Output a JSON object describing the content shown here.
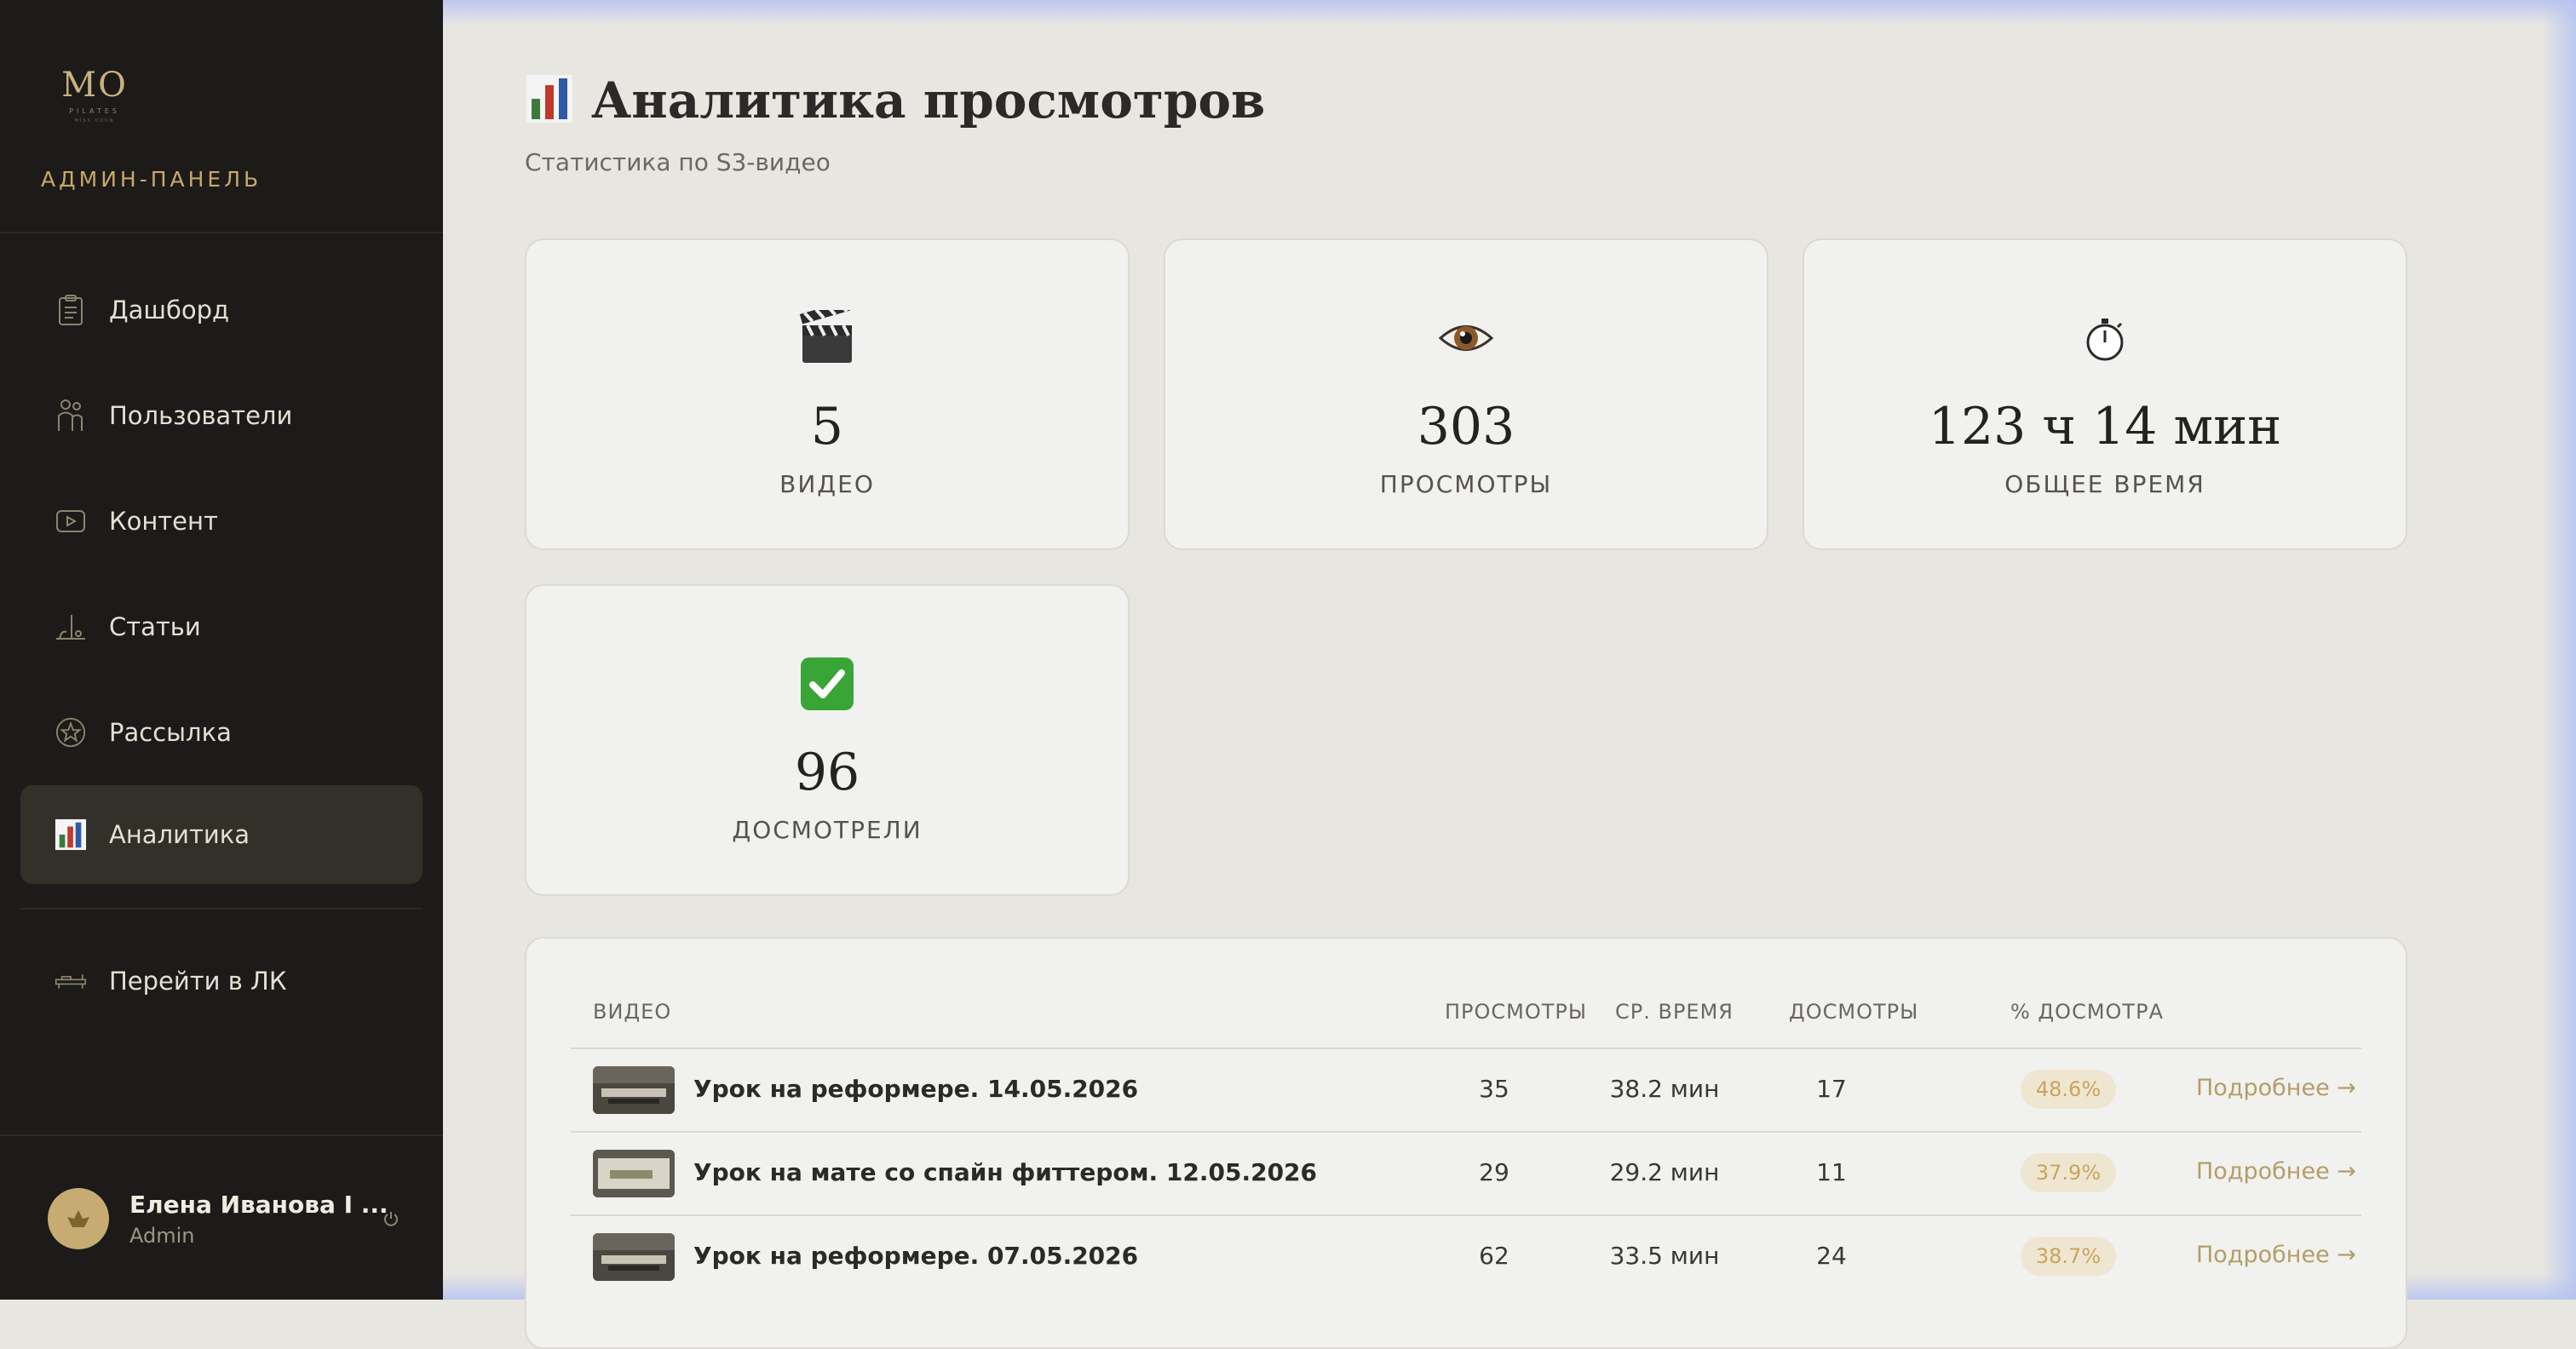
{
  "sidebar": {
    "logo_text": "MO",
    "logo_sub": "PILATES",
    "logo_sub2": "MISS ODUN",
    "brand": "АДМИН-ПАНЕЛЬ",
    "items": [
      {
        "label": "Дашборд",
        "icon": "clipboard-icon"
      },
      {
        "label": "Пользователи",
        "icon": "users-icon"
      },
      {
        "label": "Контент",
        "icon": "video-play-icon"
      },
      {
        "label": "Статьи",
        "icon": "articles-icon"
      },
      {
        "label": "Рассылка",
        "icon": "star-badge-icon"
      },
      {
        "label": "Аналитика",
        "icon": "bar-chart-icon",
        "active": true
      },
      {
        "label": "Перейти в ЛК",
        "icon": "reformer-icon"
      }
    ],
    "user": {
      "name": "Елена Иванова I ...",
      "role": "Admin"
    }
  },
  "page": {
    "title": "Аналитика просмотров",
    "subtitle": "Статистика по S3-видео"
  },
  "stats": [
    {
      "icon": "clapperboard-icon",
      "value": "5",
      "label": "ВИДЕО"
    },
    {
      "icon": "eye-icon",
      "value": "303",
      "label": "ПРОСМОТРЫ"
    },
    {
      "icon": "stopwatch-icon",
      "value": "123 ч 14 мин",
      "label": "ОБЩЕЕ ВРЕМЯ"
    },
    {
      "icon": "check-mark-icon",
      "value": "96",
      "label": "ДОСМОТРЕЛИ"
    }
  ],
  "table": {
    "columns": [
      "ВИДЕО",
      "ПРОСМОТРЫ",
      "СР. ВРЕМЯ",
      "ДОСМОТРЫ",
      "% ДОСМОТРА"
    ],
    "rows": [
      {
        "title": "Урок на реформере. 14.05.2026",
        "views": "35",
        "avg": "38.2 мин",
        "completions": "17",
        "pct": "48.6%",
        "link": "Подробнее →"
      },
      {
        "title": "Урок на мате со спайн фиттером. 12.05.2026",
        "views": "29",
        "avg": "29.2 мин",
        "completions": "11",
        "pct": "37.9%",
        "link": "Подробнее →"
      },
      {
        "title": "Урок на реформере. 07.05.2026",
        "views": "62",
        "avg": "33.5 мин",
        "completions": "24",
        "pct": "38.7%",
        "link": "Подробнее →"
      }
    ]
  },
  "colors": {
    "accent": "#c9a867",
    "sidebar_bg": "#1c1b19",
    "page_bg": "#e8e6e1",
    "badge_bg": "#efe6d2"
  }
}
